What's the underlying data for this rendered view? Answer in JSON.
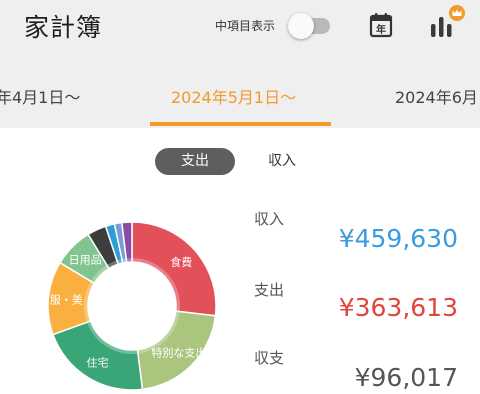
{
  "header": {
    "title": "家計簿",
    "mid_item_label": "中項目表示",
    "mid_item_toggle": false,
    "calendar_icon_text": "年",
    "calendar_icon": "calendar-year-icon",
    "chart_icon": "bar-chart-crown-icon"
  },
  "date_tabs": {
    "prev": "年4月1日〜",
    "current": "2024年5月1日〜",
    "next": "2024年6月"
  },
  "segment": {
    "selected": "支出",
    "other": "収入"
  },
  "summary": {
    "income_label": "収入",
    "income_value": "¥459,630",
    "expense_label": "支出",
    "expense_value": "¥363,613",
    "balance_label": "収支",
    "balance_value": "¥96,017"
  },
  "chart_data": {
    "type": "pie",
    "labels": [
      "食費",
      "特別な支出",
      "住宅",
      "服・美",
      "日用品",
      "",
      "",
      "",
      ""
    ],
    "values": [
      26.4,
      20.8,
      21.1,
      13.9,
      7.5,
      3.6,
      1.7,
      1.4,
      1.9
    ],
    "colors": [
      "#e2505a",
      "#a9c57e",
      "#3aa677",
      "#f9b040",
      "#82c48f",
      "#3d3d3d",
      "#2d9fd6",
      "#7b9bd9",
      "#8a4ba8"
    ],
    "start_angle_deg": 0,
    "donut": true
  }
}
